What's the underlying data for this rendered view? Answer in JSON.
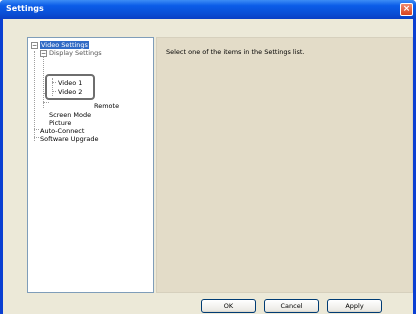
{
  "window": {
    "title": "Settings",
    "close_glyph": "×"
  },
  "tree": {
    "root": "Video Settings",
    "child_partial": "Display Settings",
    "video1": "Video 1",
    "video2": "Video 2",
    "remote_partial": "Remote",
    "screen_mode": "Screen Mode",
    "picture": "Picture",
    "auto_connect": "Auto-Connect",
    "software_upgrade": "Software Upgrade",
    "collapse_glyph": "−"
  },
  "info": {
    "message": "Select one of the items in the Settings list."
  },
  "buttons": {
    "ok": "OK",
    "cancel": "Cancel",
    "apply": "Apply"
  },
  "colors": {
    "titlebar": "#0a4fd6",
    "selection": "#316ac5",
    "panel": "#e3dcc8",
    "client": "#ece9d8"
  }
}
